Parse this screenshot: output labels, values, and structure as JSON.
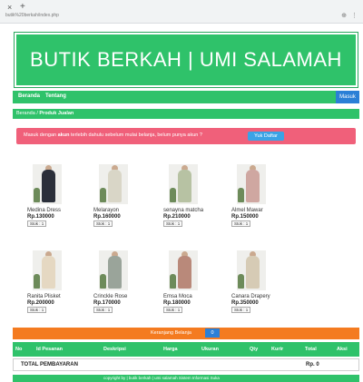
{
  "browser": {
    "url": "butik%20berkah/index.php",
    "close_glyph": "×",
    "new_tab_glyph": "+"
  },
  "banner": {
    "title": "BUTIK BERKAH | UMI SALAMAH"
  },
  "nav": {
    "items": [
      "Beranda",
      "Tentang"
    ],
    "login": "Masuk"
  },
  "breadcrumb": {
    "home": "Beranda",
    "current": "Produk Jualan"
  },
  "alert": {
    "text_prefix": "Masuk dengan ",
    "text_bold": "akun",
    "text_suffix": " terlebih dahulu sebelum mulai belanja, belum punya akun ?",
    "button": "Yuk Daftar"
  },
  "products": [
    {
      "name": "Medina Dress",
      "price": "Rp.130000",
      "stock": "Stok : 1",
      "color": "#2b2f3a"
    },
    {
      "name": "Melarayon",
      "price": "Rp.160000",
      "stock": "Stok : 1",
      "color": "#d9d6c7"
    },
    {
      "name": "senayna matcha",
      "price": "Rp.210000",
      "stock": "Stok : 1",
      "color": "#b7c2a3"
    },
    {
      "name": "Almel Mawar",
      "price": "Rp.150000",
      "stock": "Stok : 1",
      "color": "#cfa7a1"
    },
    {
      "name": "Ranita Plisket",
      "price": "Rp.200000",
      "stock": "Stok : 1",
      "color": "#e5d8c2"
    },
    {
      "name": "Crinckle Rose",
      "price": "Rp.170000",
      "stock": "Stok : 1",
      "color": "#9aa49a"
    },
    {
      "name": "Emsa Moca",
      "price": "Rp.180000",
      "stock": "Stok : 1",
      "color": "#b9897a"
    },
    {
      "name": "Canara Drapery",
      "price": "Rp.350000",
      "stock": "Stok : 1",
      "color": "#d6cbb5"
    }
  ],
  "cart": {
    "label": "Keranjang Belanja",
    "count": "0",
    "columns": [
      "No",
      "Id Pesanan",
      "Deskripsi",
      "Harga",
      "Ukuran",
      "Qty",
      "Kurir",
      "Total",
      "Aksi"
    ],
    "total_label": "TOTAL PEMBAYARAN",
    "total_value": "Rp. 0"
  },
  "footer": {
    "text": "copyright by | butik berkah | umi salamah  Sistem Informasi Suka"
  },
  "colors": {
    "green": "#2fc26a",
    "orange": "#f47b20",
    "blue": "#2a7fd6",
    "pink": "#f0607a"
  }
}
